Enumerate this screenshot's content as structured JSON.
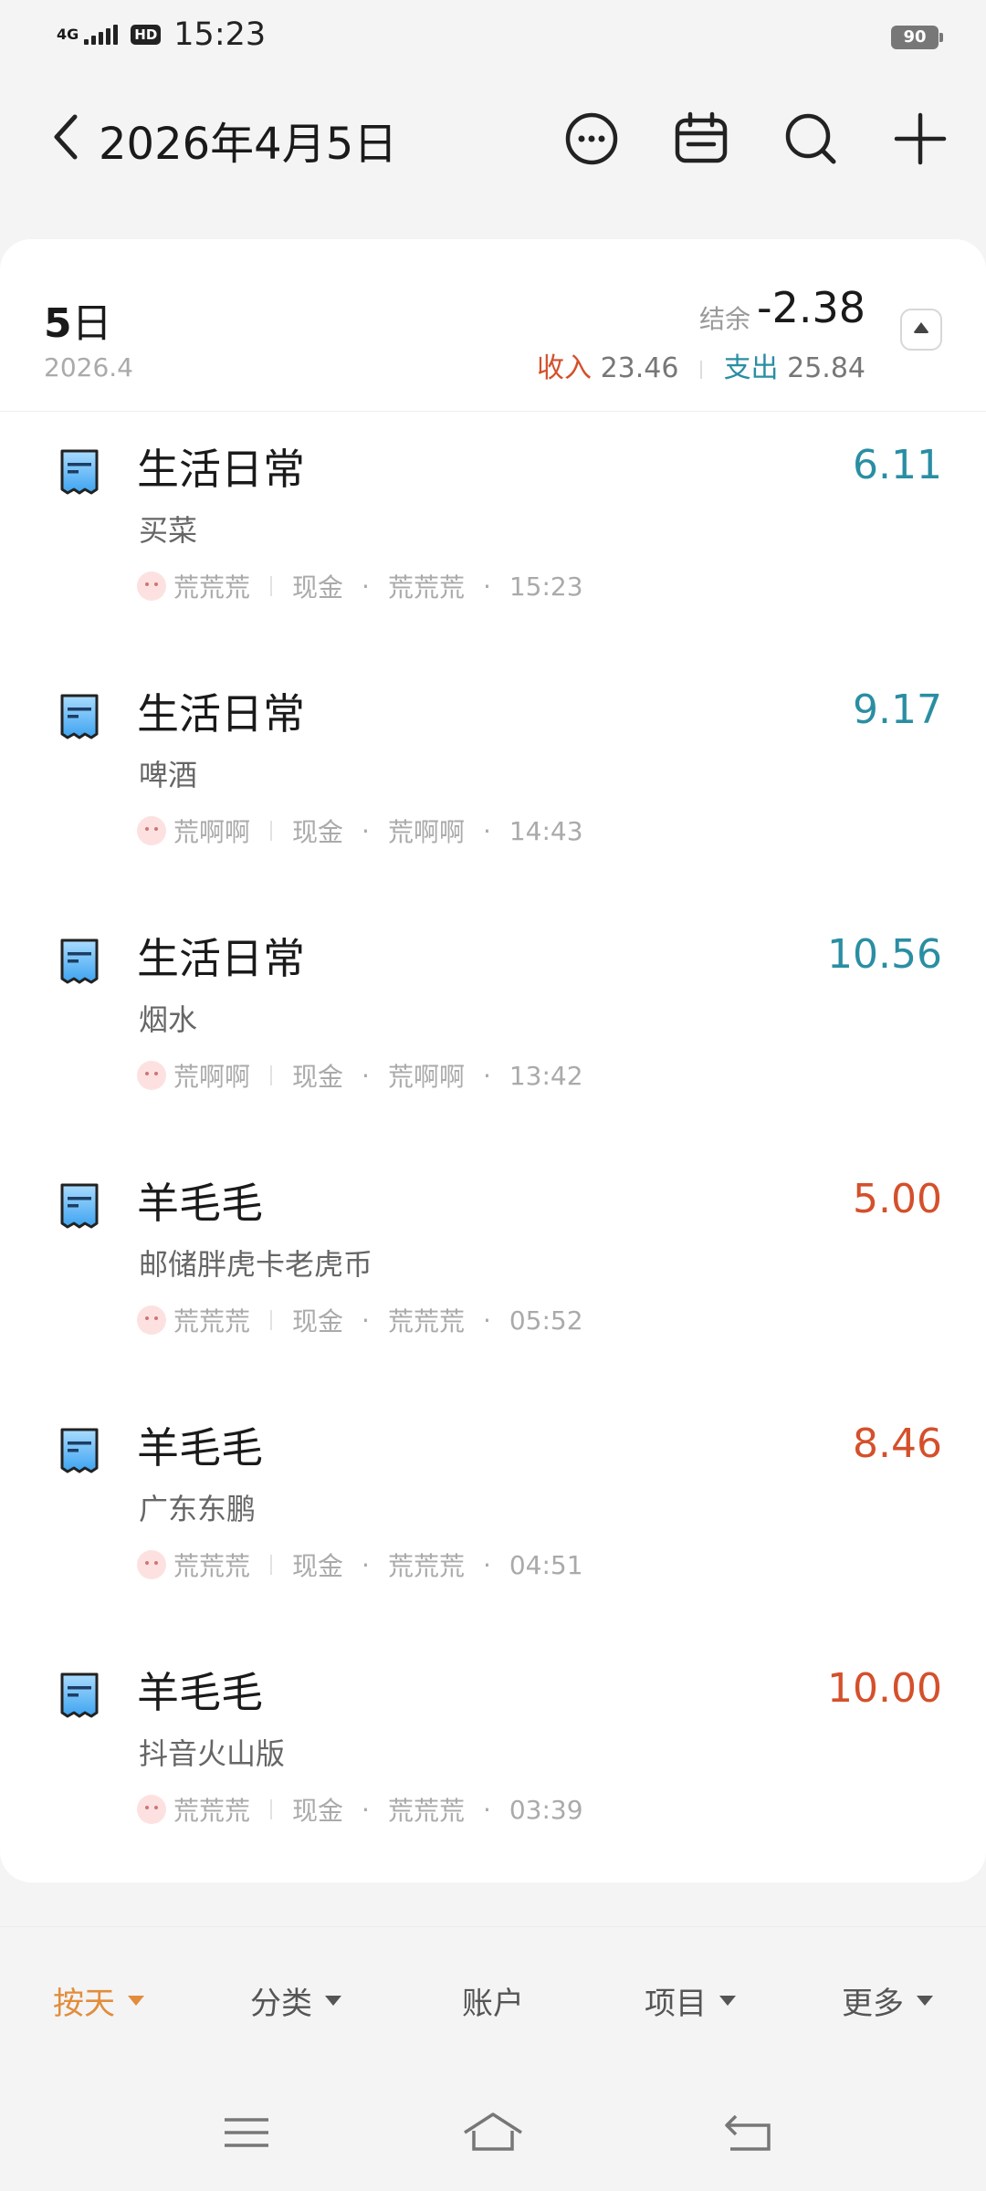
{
  "status_bar": {
    "network": "4G",
    "hd": "HD",
    "time": "15:23",
    "battery": "90"
  },
  "header": {
    "title": "2026年4月5日",
    "actions": [
      "more-icon",
      "calendar-icon",
      "search-icon",
      "add-icon"
    ]
  },
  "summary": {
    "day": "5",
    "day_suffix": "日",
    "year_month": "2026.4",
    "balance_label": "结余",
    "balance_value": "-2.38",
    "income_label": "收入",
    "income_value": "23.46",
    "expense_label": "支出",
    "expense_value": "25.84"
  },
  "records": [
    {
      "category": "生活日常",
      "note": "买菜",
      "amount": "6.11",
      "type": "expense",
      "member": "荒荒荒",
      "account": "现金",
      "recorder": "荒荒荒",
      "time": "15:23"
    },
    {
      "category": "生活日常",
      "note": "啤酒",
      "amount": "9.17",
      "type": "expense",
      "member": "荒啊啊",
      "account": "现金",
      "recorder": "荒啊啊",
      "time": "14:43"
    },
    {
      "category": "生活日常",
      "note": "烟水",
      "amount": "10.56",
      "type": "expense",
      "member": "荒啊啊",
      "account": "现金",
      "recorder": "荒啊啊",
      "time": "13:42"
    },
    {
      "category": "羊毛毛",
      "note": "邮储胖虎卡老虎币",
      "amount": "5.00",
      "type": "income",
      "member": "荒荒荒",
      "account": "现金",
      "recorder": "荒荒荒",
      "time": "05:52"
    },
    {
      "category": "羊毛毛",
      "note": "广东东鹏",
      "amount": "8.46",
      "type": "income",
      "member": "荒荒荒",
      "account": "现金",
      "recorder": "荒荒荒",
      "time": "04:51"
    },
    {
      "category": "羊毛毛",
      "note": "抖音火山版",
      "amount": "10.00",
      "type": "income",
      "member": "荒荒荒",
      "account": "现金",
      "recorder": "荒荒荒",
      "time": "03:39"
    }
  ],
  "tabs": [
    {
      "label": "按天",
      "dropdown": true,
      "active": true
    },
    {
      "label": "分类",
      "dropdown": true,
      "active": false
    },
    {
      "label": "账户",
      "dropdown": false,
      "active": false
    },
    {
      "label": "项目",
      "dropdown": true,
      "active": false
    },
    {
      "label": "更多",
      "dropdown": true,
      "active": false
    }
  ],
  "colors": {
    "income": "#d4502b",
    "expense": "#2a8ea3",
    "active_tab": "#e28d3b"
  }
}
